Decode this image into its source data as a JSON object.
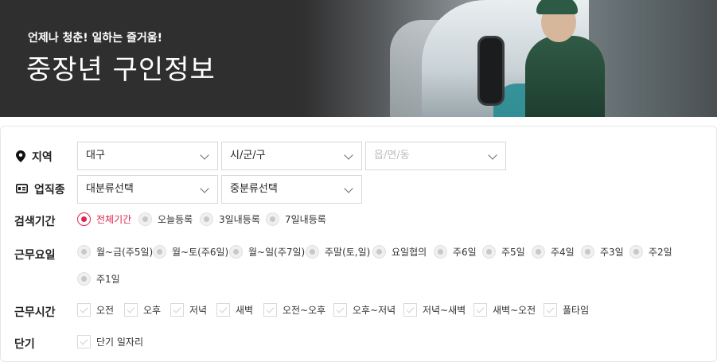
{
  "banner": {
    "subtitle": "언제나 청춘! 일하는 즐거움!",
    "title": "중장년 구인정보"
  },
  "filters": {
    "region": {
      "label": "지역",
      "icon": "location-pin-icon",
      "selects": [
        "대구",
        "시/군/구",
        "읍/면/동"
      ]
    },
    "job_type": {
      "label": "업직종",
      "icon": "id-card-icon",
      "selects": [
        "대분류선택",
        "중분류선택"
      ]
    },
    "period": {
      "label": "검색기간",
      "selected": "전체기간",
      "options": [
        "전체기간",
        "오늘등록",
        "3일내등록",
        "7일내등록"
      ]
    },
    "workdays": {
      "label": "근무요일",
      "options": [
        "월~금(주5일)",
        "월~토(주6일)",
        "월~일(주7일)",
        "주말(토,일)",
        "요일협의",
        "주6일",
        "주5일",
        "주4일",
        "주3일",
        "주2일",
        "주1일"
      ]
    },
    "worktime": {
      "label": "근무시간",
      "options": [
        "오전",
        "오후",
        "저녁",
        "새벽",
        "오전~오후",
        "오후~저녁",
        "저녁~새벽",
        "새벽~오전",
        "풀타임"
      ]
    },
    "shortterm": {
      "label": "단기",
      "options": [
        "단기 일자리"
      ]
    }
  },
  "colors": {
    "accent": "#e0244d",
    "banner_bg": "#2f2f2f"
  }
}
